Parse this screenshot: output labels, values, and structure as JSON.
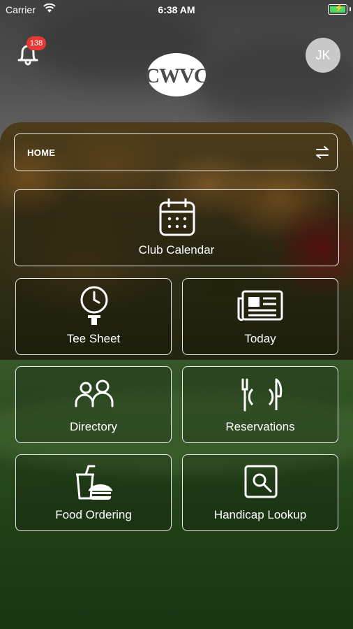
{
  "status_bar": {
    "carrier": "Carrier",
    "time": "6:38 AM"
  },
  "header": {
    "notification_count": "138",
    "logo_text": "CWVC",
    "avatar_initials": "JK"
  },
  "selector": {
    "label": "HOME",
    "icon": "swap-arrows-icon"
  },
  "tiles": [
    {
      "label": "Club Calendar",
      "icon": "calendar-icon"
    },
    {
      "label": "Tee Sheet",
      "icon": "clock-tee-icon"
    },
    {
      "label": "Today",
      "icon": "newspaper-icon"
    },
    {
      "label": "Directory",
      "icon": "people-icon"
    },
    {
      "label": "Reservations",
      "icon": "dining-icon"
    },
    {
      "label": "Food Ordering",
      "icon": "food-drink-icon"
    },
    {
      "label": "Handicap Lookup",
      "icon": "search-document-icon"
    }
  ],
  "colors": {
    "badge": "#e53935",
    "battery": "#4cd964",
    "avatar": "#c8c8c8"
  }
}
